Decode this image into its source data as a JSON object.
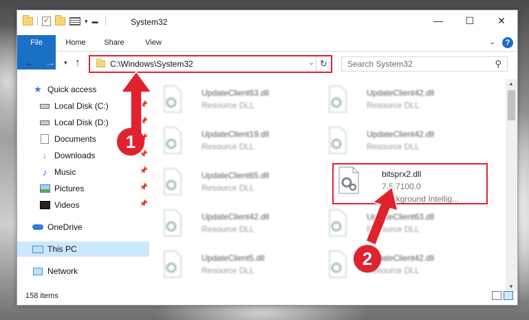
{
  "window": {
    "title": "System32",
    "minimize": "—",
    "maximize": "☐",
    "close": "✕"
  },
  "ribbon": {
    "tabs": [
      "File",
      "Home",
      "Share",
      "View"
    ],
    "help": "?"
  },
  "address": {
    "path": "C:\\Windows\\System32",
    "search_placeholder": "Search System32"
  },
  "nav_pane": {
    "items": [
      {
        "label": "Quick access",
        "icon": "star-icon"
      },
      {
        "label": "Local Disk (C:)",
        "icon": "drive-icon",
        "pinned": true
      },
      {
        "label": "Local Disk (D:)",
        "icon": "drive-icon",
        "pinned": true
      },
      {
        "label": "Documents",
        "icon": "documents-icon",
        "pinned": true
      },
      {
        "label": "Downloads",
        "icon": "download-icon",
        "pinned": true
      },
      {
        "label": "Music",
        "icon": "music-icon",
        "pinned": true
      },
      {
        "label": "Pictures",
        "icon": "pictures-icon",
        "pinned": true
      },
      {
        "label": "Videos",
        "icon": "videos-icon",
        "pinned": true
      },
      {
        "label": "OneDrive",
        "icon": "cloud-icon"
      },
      {
        "label": "This PC",
        "icon": "computer-icon",
        "selected": true
      },
      {
        "label": "Network",
        "icon": "network-icon"
      }
    ]
  },
  "files": {
    "items": [
      {
        "name": "UpdateClient63.dll",
        "meta": "Resource DLL",
        "blurred": true
      },
      {
        "name": "UpdateClient42.dll",
        "meta": "Resource DLL",
        "blurred": true
      },
      {
        "name": "UpdateClient19.dll",
        "meta": "Resource DLL",
        "blurred": true
      },
      {
        "name": "UpdateClient42.dll",
        "meta": "Resource DLL",
        "blurred": true
      },
      {
        "name": "UpdateClient65.dll",
        "meta": "Resource DLL",
        "blurred": true
      },
      {
        "name": "bitsprx2.dll",
        "meta": "7.5.7100.0",
        "meta2": "Background Intellig...",
        "blurred": false
      },
      {
        "name": "UpdateClient42.dll",
        "meta": "Resource DLL",
        "blurred": true
      },
      {
        "name": "UpdateClient63.dll",
        "meta": "Resource DLL",
        "blurred": true
      },
      {
        "name": "UpdateClient5.dll",
        "meta": "Resource DLL",
        "blurred": true
      },
      {
        "name": "UpdateClient42.dll",
        "meta": "Resource DLL",
        "blurred": true
      }
    ]
  },
  "status": {
    "count": "158 items"
  },
  "callouts": {
    "one": "1",
    "two": "2",
    "color": "#e0222f"
  }
}
